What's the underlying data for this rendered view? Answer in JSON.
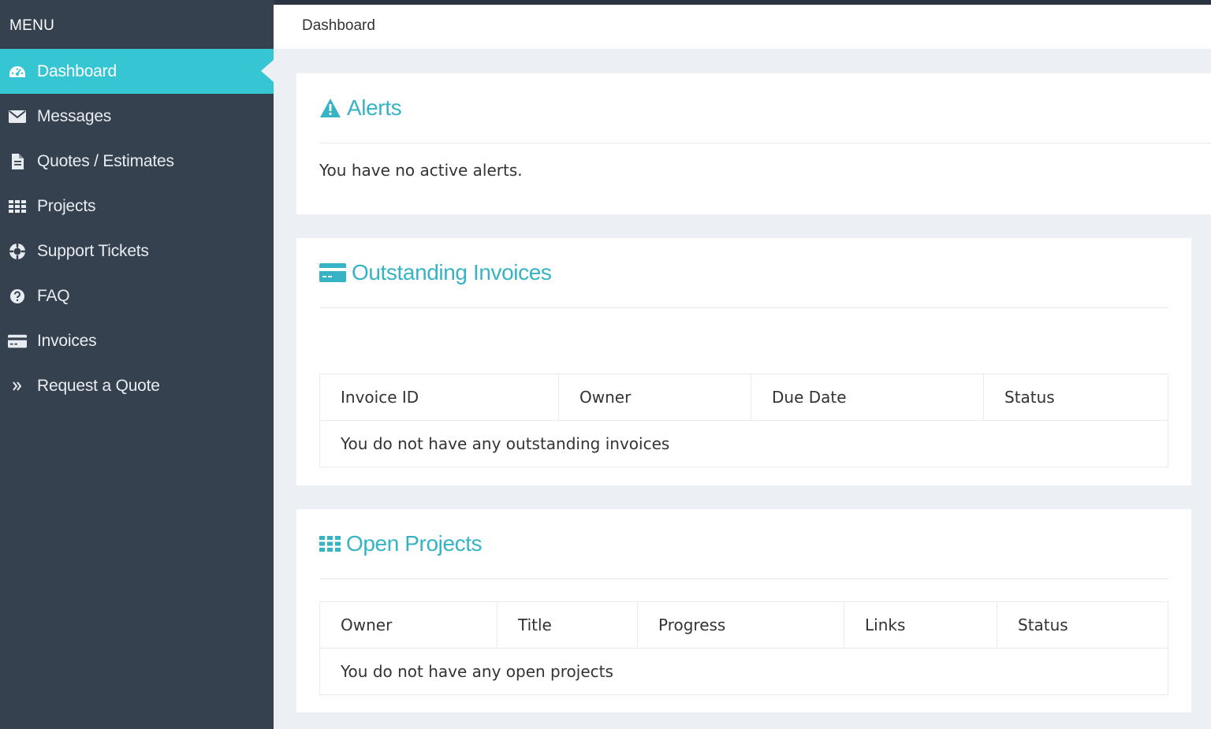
{
  "sidebar": {
    "menu_header": "MENU",
    "items": [
      {
        "label": "Dashboard",
        "icon": "dashboard-icon",
        "active": true
      },
      {
        "label": "Messages",
        "icon": "envelope-icon"
      },
      {
        "label": "Quotes / Estimates",
        "icon": "document-icon"
      },
      {
        "label": "Projects",
        "icon": "grid-icon"
      },
      {
        "label": "Support Tickets",
        "icon": "lifebuoy-icon"
      },
      {
        "label": "FAQ",
        "icon": "question-circle-icon"
      },
      {
        "label": "Invoices",
        "icon": "credit-card-icon"
      },
      {
        "label": "Request a Quote",
        "icon": "double-chevron-right-icon"
      }
    ]
  },
  "header": {
    "breadcrumb": "Dashboard"
  },
  "alerts": {
    "title": "Alerts",
    "icon": "warning-triangle-icon",
    "message": "You have no active alerts."
  },
  "invoices": {
    "title": "Outstanding Invoices",
    "icon": "credit-card-icon",
    "columns": [
      "Invoice ID",
      "Owner",
      "Due Date",
      "Status"
    ],
    "empty_message": "You do not have any outstanding invoices"
  },
  "projects": {
    "title": "Open Projects",
    "icon": "grid-icon",
    "columns": [
      "Owner",
      "Title",
      "Progress",
      "Links",
      "Status"
    ],
    "empty_message": "You do not have any open projects"
  },
  "colors": {
    "sidebar_bg": "#364150",
    "accent": "#36c6d3",
    "title_color": "#36b3c4",
    "page_bg": "#eceff3"
  }
}
